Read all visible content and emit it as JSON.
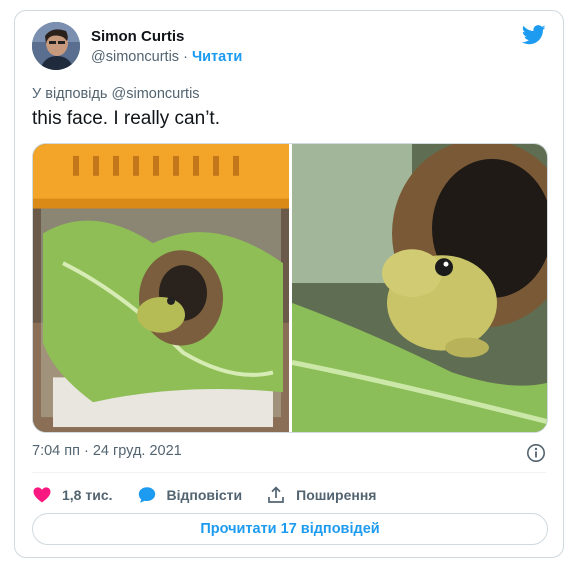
{
  "author": {
    "name": "Simon Curtis",
    "handle": "@simoncurtis",
    "separator": "·",
    "follow_label": "Читати"
  },
  "reply_to": "У відповідь @simoncurtis",
  "tweet_text": "this face. I really can’t.",
  "timestamp": "7:04 пп · 24 груд. 2021",
  "actions": {
    "likes_count": "1,8 тис.",
    "reply_label": "Відповісти",
    "share_label": "Поширення"
  },
  "read_replies_label": "Прочитати 17 відповідей",
  "colors": {
    "accent": "#1d9bf0",
    "like": "#f91880",
    "muted": "#536471"
  },
  "icons": [
    "twitter-bird-icon",
    "info-icon",
    "heart-icon",
    "speech-bubble-icon",
    "share-icon"
  ]
}
